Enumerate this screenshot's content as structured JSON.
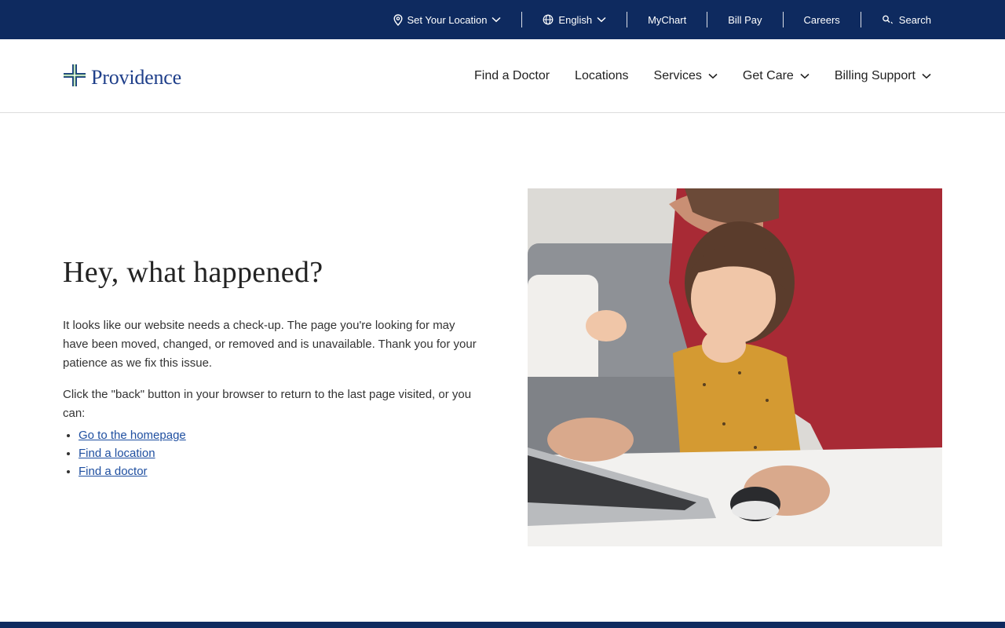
{
  "utility_bar": {
    "location_label": "Set Your Location",
    "language_label": "English",
    "mychart_label": "MyChart",
    "billpay_label": "Bill Pay",
    "careers_label": "Careers",
    "search_label": "Search"
  },
  "header": {
    "logo_text": "Providence",
    "nav": {
      "find_doctor": "Find a Doctor",
      "locations": "Locations",
      "services": "Services",
      "get_care": "Get Care",
      "billing_support": "Billing Support"
    }
  },
  "main": {
    "title": "Hey, what happened?",
    "paragraph_1": "It looks like our website needs a check-up. The page you're looking for may have been moved, changed, or removed and is unavailable. Thank you for your patience as we fix this issue.",
    "paragraph_2": "Click the \"back\" button in your browser to return to the last page visited, or you can:",
    "links": {
      "homepage": "Go to the homepage",
      "location": "Find a location",
      "doctor": "Find a doctor"
    }
  },
  "colors": {
    "brand_navy": "#0e2a5f",
    "logo_blue": "#1f3f8a",
    "logo_green": "#3f9a3c",
    "link_blue": "#1f4fa0"
  }
}
